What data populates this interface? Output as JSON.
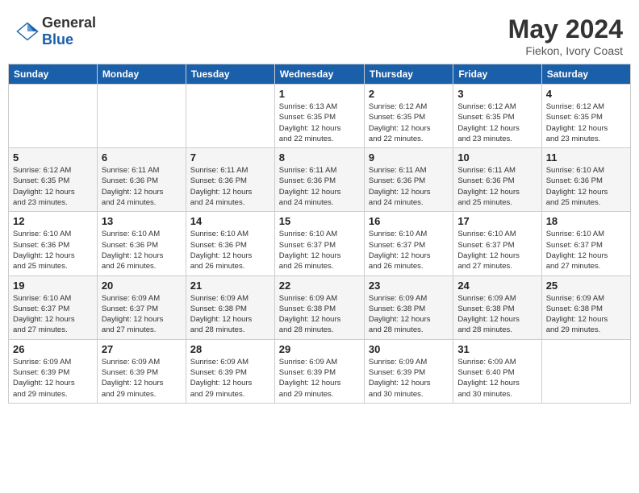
{
  "header": {
    "logo_general": "General",
    "logo_blue": "Blue",
    "title": "May 2024",
    "location": "Fiekon, Ivory Coast"
  },
  "weekdays": [
    "Sunday",
    "Monday",
    "Tuesday",
    "Wednesday",
    "Thursday",
    "Friday",
    "Saturday"
  ],
  "weeks": [
    [
      {
        "day": "",
        "info": ""
      },
      {
        "day": "",
        "info": ""
      },
      {
        "day": "",
        "info": ""
      },
      {
        "day": "1",
        "info": "Sunrise: 6:13 AM\nSunset: 6:35 PM\nDaylight: 12 hours\nand 22 minutes."
      },
      {
        "day": "2",
        "info": "Sunrise: 6:12 AM\nSunset: 6:35 PM\nDaylight: 12 hours\nand 22 minutes."
      },
      {
        "day": "3",
        "info": "Sunrise: 6:12 AM\nSunset: 6:35 PM\nDaylight: 12 hours\nand 23 minutes."
      },
      {
        "day": "4",
        "info": "Sunrise: 6:12 AM\nSunset: 6:35 PM\nDaylight: 12 hours\nand 23 minutes."
      }
    ],
    [
      {
        "day": "5",
        "info": "Sunrise: 6:12 AM\nSunset: 6:35 PM\nDaylight: 12 hours\nand 23 minutes."
      },
      {
        "day": "6",
        "info": "Sunrise: 6:11 AM\nSunset: 6:36 PM\nDaylight: 12 hours\nand 24 minutes."
      },
      {
        "day": "7",
        "info": "Sunrise: 6:11 AM\nSunset: 6:36 PM\nDaylight: 12 hours\nand 24 minutes."
      },
      {
        "day": "8",
        "info": "Sunrise: 6:11 AM\nSunset: 6:36 PM\nDaylight: 12 hours\nand 24 minutes."
      },
      {
        "day": "9",
        "info": "Sunrise: 6:11 AM\nSunset: 6:36 PM\nDaylight: 12 hours\nand 24 minutes."
      },
      {
        "day": "10",
        "info": "Sunrise: 6:11 AM\nSunset: 6:36 PM\nDaylight: 12 hours\nand 25 minutes."
      },
      {
        "day": "11",
        "info": "Sunrise: 6:10 AM\nSunset: 6:36 PM\nDaylight: 12 hours\nand 25 minutes."
      }
    ],
    [
      {
        "day": "12",
        "info": "Sunrise: 6:10 AM\nSunset: 6:36 PM\nDaylight: 12 hours\nand 25 minutes."
      },
      {
        "day": "13",
        "info": "Sunrise: 6:10 AM\nSunset: 6:36 PM\nDaylight: 12 hours\nand 26 minutes."
      },
      {
        "day": "14",
        "info": "Sunrise: 6:10 AM\nSunset: 6:36 PM\nDaylight: 12 hours\nand 26 minutes."
      },
      {
        "day": "15",
        "info": "Sunrise: 6:10 AM\nSunset: 6:37 PM\nDaylight: 12 hours\nand 26 minutes."
      },
      {
        "day": "16",
        "info": "Sunrise: 6:10 AM\nSunset: 6:37 PM\nDaylight: 12 hours\nand 26 minutes."
      },
      {
        "day": "17",
        "info": "Sunrise: 6:10 AM\nSunset: 6:37 PM\nDaylight: 12 hours\nand 27 minutes."
      },
      {
        "day": "18",
        "info": "Sunrise: 6:10 AM\nSunset: 6:37 PM\nDaylight: 12 hours\nand 27 minutes."
      }
    ],
    [
      {
        "day": "19",
        "info": "Sunrise: 6:10 AM\nSunset: 6:37 PM\nDaylight: 12 hours\nand 27 minutes."
      },
      {
        "day": "20",
        "info": "Sunrise: 6:09 AM\nSunset: 6:37 PM\nDaylight: 12 hours\nand 27 minutes."
      },
      {
        "day": "21",
        "info": "Sunrise: 6:09 AM\nSunset: 6:38 PM\nDaylight: 12 hours\nand 28 minutes."
      },
      {
        "day": "22",
        "info": "Sunrise: 6:09 AM\nSunset: 6:38 PM\nDaylight: 12 hours\nand 28 minutes."
      },
      {
        "day": "23",
        "info": "Sunrise: 6:09 AM\nSunset: 6:38 PM\nDaylight: 12 hours\nand 28 minutes."
      },
      {
        "day": "24",
        "info": "Sunrise: 6:09 AM\nSunset: 6:38 PM\nDaylight: 12 hours\nand 28 minutes."
      },
      {
        "day": "25",
        "info": "Sunrise: 6:09 AM\nSunset: 6:38 PM\nDaylight: 12 hours\nand 29 minutes."
      }
    ],
    [
      {
        "day": "26",
        "info": "Sunrise: 6:09 AM\nSunset: 6:39 PM\nDaylight: 12 hours\nand 29 minutes."
      },
      {
        "day": "27",
        "info": "Sunrise: 6:09 AM\nSunset: 6:39 PM\nDaylight: 12 hours\nand 29 minutes."
      },
      {
        "day": "28",
        "info": "Sunrise: 6:09 AM\nSunset: 6:39 PM\nDaylight: 12 hours\nand 29 minutes."
      },
      {
        "day": "29",
        "info": "Sunrise: 6:09 AM\nSunset: 6:39 PM\nDaylight: 12 hours\nand 29 minutes."
      },
      {
        "day": "30",
        "info": "Sunrise: 6:09 AM\nSunset: 6:39 PM\nDaylight: 12 hours\nand 30 minutes."
      },
      {
        "day": "31",
        "info": "Sunrise: 6:09 AM\nSunset: 6:40 PM\nDaylight: 12 hours\nand 30 minutes."
      },
      {
        "day": "",
        "info": ""
      }
    ]
  ]
}
